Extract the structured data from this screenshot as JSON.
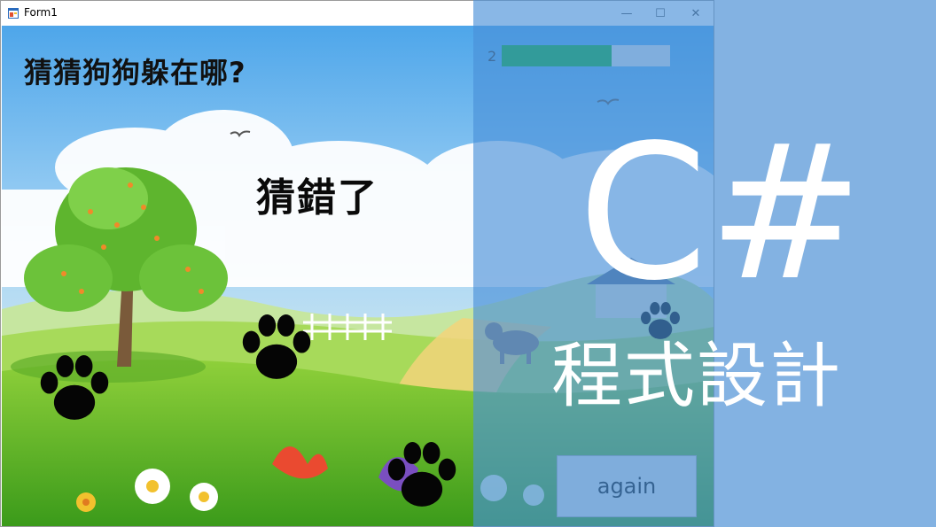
{
  "window": {
    "title": "Form1",
    "minimize_label": "—",
    "maximize_label": "☐",
    "close_label": "✕"
  },
  "game": {
    "title": "猜猜狗狗躲在哪?",
    "result": "猜錯了",
    "counter": "2",
    "progress": 0.65,
    "again_label": "again"
  },
  "overlay": {
    "heading": "C#",
    "subheading": "程式設計"
  },
  "colors": {
    "overlay_blue": "#4a90d9",
    "progress_green": "#06b025",
    "sky_top": "#5aaee8"
  },
  "icons": [
    "app-form-icon",
    "paw-icon",
    "bird-icon",
    "tree-icon",
    "flower-icon",
    "dog-icon",
    "house-icon"
  ]
}
